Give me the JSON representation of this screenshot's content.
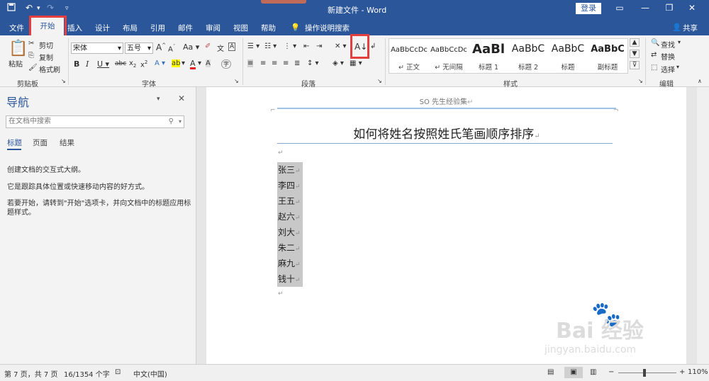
{
  "window": {
    "title": "新建文件 - Word",
    "login": "登录"
  },
  "qat": {
    "save_icon": "save-icon",
    "undo_icon": "undo-icon",
    "redo_icon": "redo-icon",
    "customize_icon": "customize-icon"
  },
  "tabs": {
    "file": "文件",
    "home": "开始",
    "insert": "插入",
    "design": "设计",
    "layout": "布局",
    "references": "引用",
    "mailings": "邮件",
    "review": "审阅",
    "view": "视图",
    "help": "帮助",
    "tellme": "操作说明搜索",
    "share": "共享"
  },
  "clipboard": {
    "paste": "粘贴",
    "cut": "剪切",
    "copy": "复制",
    "format_painter": "格式刷",
    "label": "剪贴板"
  },
  "font": {
    "name": "宋体",
    "size": "五号",
    "label": "字体",
    "case": "Aa",
    "grow": "A",
    "shrink": "A"
  },
  "paragraph": {
    "label": "段落"
  },
  "styles": {
    "label": "样式",
    "items": [
      {
        "preview": "AaBbCcDc",
        "name": "正文"
      },
      {
        "preview": "AaBbCcDc",
        "name": "无间隔"
      },
      {
        "preview": "AaBl",
        "name": "标题 1"
      },
      {
        "preview": "AaBbC",
        "name": "标题 2"
      },
      {
        "preview": "AaBbC",
        "name": "标题"
      },
      {
        "preview": "AaBbC",
        "name": "副标题"
      }
    ]
  },
  "editing": {
    "find": "查找",
    "replace": "替换",
    "select": "选择",
    "label": "编辑"
  },
  "nav": {
    "title": "导航",
    "search_placeholder": "在文档中搜索",
    "tabs": [
      "标题",
      "页面",
      "结果"
    ],
    "text1": "创建文档的交互式大纲。",
    "text2": "它是跟踪具体位置或快速移动内容的好方式。",
    "text3": "若要开始，请转到\"开始\"选项卡，并向文档中的标题应用标题样式。"
  },
  "document": {
    "header": "SO 先生经验集",
    "title": "如何将姓名按照姓氏笔画顺序排序",
    "names": [
      "张三",
      "李四",
      "王五",
      "赵六",
      "刘大",
      "朱二",
      "麻九",
      "钱十"
    ]
  },
  "status": {
    "page": "第 7 页，共 7 页",
    "words": "16/1354 个字",
    "language": "中文(中国)",
    "zoom": "110%",
    "zoom_level": 0.45
  },
  "watermark": {
    "brand": "Bai 经验",
    "url": "jingyan.baidu.com"
  },
  "colors": {
    "accent": "#2b579a",
    "highlight_box": "#e43f3f"
  }
}
